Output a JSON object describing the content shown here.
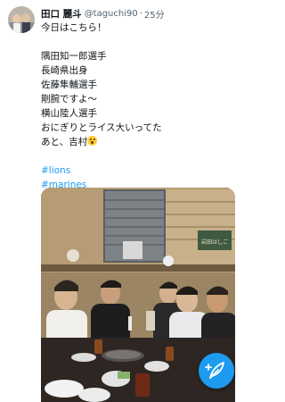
{
  "tweet": {
    "display_name": "田口 麗斗",
    "handle": "@taguchi90",
    "separator": "·",
    "timestamp": "25分",
    "lines": [
      "今日はこちら！",
      "",
      "隅田知一郎選手",
      "長崎県出身",
      "佐藤隼輔選手",
      "剛腕ですよ～",
      "横山陸人選手",
      "おにぎりとライス大いってた",
      "あと、吉村"
    ],
    "hashtags": [
      "#lions",
      "#marines"
    ],
    "emoji_icon": "surprised-face-emoji",
    "photo_sign_text": "岩田はしご"
  },
  "compose_button": {
    "icon": "feather-compose-icon"
  },
  "colors": {
    "accent": "#1d9bf0",
    "text": "#0f1419",
    "secondary": "#536471"
  }
}
